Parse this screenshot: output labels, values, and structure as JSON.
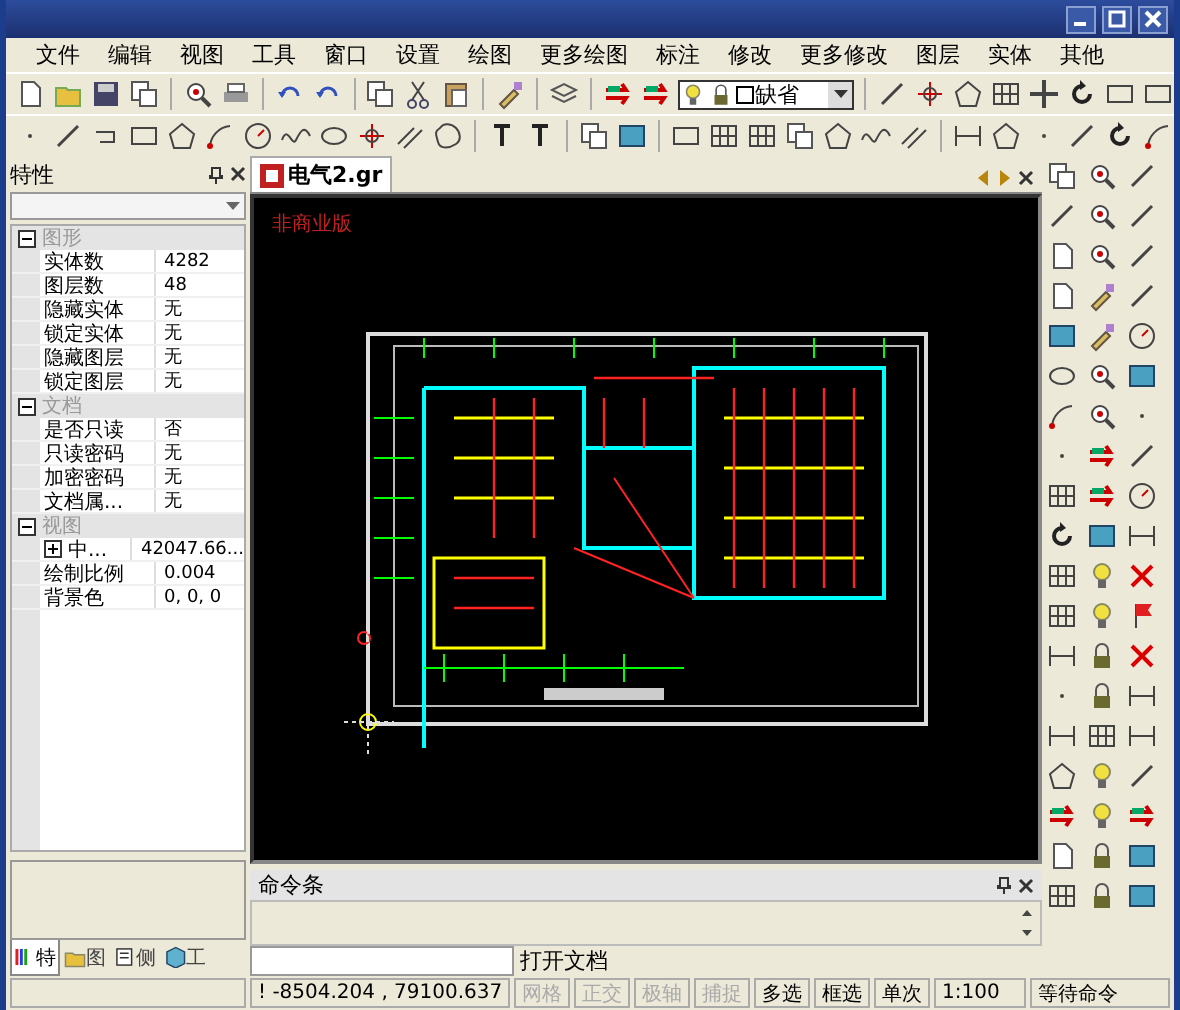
{
  "menu": [
    "文件",
    "编辑",
    "视图",
    "工具",
    "窗口",
    "设置",
    "绘图",
    "更多绘图",
    "标注",
    "修改",
    "更多修改",
    "图层",
    "实体",
    "其他"
  ],
  "layer_box": {
    "value": "缺省"
  },
  "properties": {
    "title": "特性",
    "groups": [
      {
        "label": "图形",
        "expanded": true,
        "rows": [
          {
            "kind": "plain",
            "name": "实体数",
            "value": "4282"
          },
          {
            "kind": "plain",
            "name": "图层数",
            "value": "48"
          },
          {
            "kind": "plain",
            "name": "隐藏实体",
            "value": "无"
          },
          {
            "kind": "plain",
            "name": "锁定实体",
            "value": "无"
          },
          {
            "kind": "plain",
            "name": "隐藏图层",
            "value": "无"
          },
          {
            "kind": "plain",
            "name": "锁定图层",
            "value": "无"
          }
        ]
      },
      {
        "label": "文档",
        "expanded": true,
        "rows": [
          {
            "kind": "plain",
            "name": "是否只读",
            "value": "否"
          },
          {
            "kind": "plain",
            "name": "只读密码",
            "value": "无"
          },
          {
            "kind": "plain",
            "name": "加密密码",
            "value": "无"
          },
          {
            "kind": "plain",
            "name": "文档属...",
            "value": "无"
          }
        ]
      },
      {
        "label": "视图",
        "expanded": true,
        "rows": [
          {
            "kind": "expandable",
            "expanded": false,
            "name": "中...",
            "value": "42047.66..."
          },
          {
            "kind": "plain",
            "name": "绘制比例",
            "value": "0.004"
          },
          {
            "kind": "plain",
            "name": "背景色",
            "value": "0, 0, 0"
          }
        ]
      }
    ]
  },
  "panel_tabs": [
    {
      "label": "特",
      "selected": true
    },
    {
      "label": "图",
      "selected": false
    },
    {
      "label": "侧",
      "selected": false
    },
    {
      "label": "工",
      "selected": false
    }
  ],
  "doc_tabs": [
    {
      "label": "电气2.gr",
      "selected": true
    }
  ],
  "canvas": {
    "stamp": "非商业版"
  },
  "command": {
    "title": "命令条",
    "prompt": "打开文档"
  },
  "status": {
    "coords": "! -8504.204 , 79100.637",
    "toggles": [
      {
        "label": "网格",
        "on": false
      },
      {
        "label": "正交",
        "on": false
      },
      {
        "label": "极轴",
        "on": false
      },
      {
        "label": "捕捉",
        "on": false
      },
      {
        "label": "多选",
        "on": true
      },
      {
        "label": "框选",
        "on": true
      },
      {
        "label": "单次",
        "on": true
      }
    ],
    "scale": "1:100",
    "message": "等待命令"
  }
}
